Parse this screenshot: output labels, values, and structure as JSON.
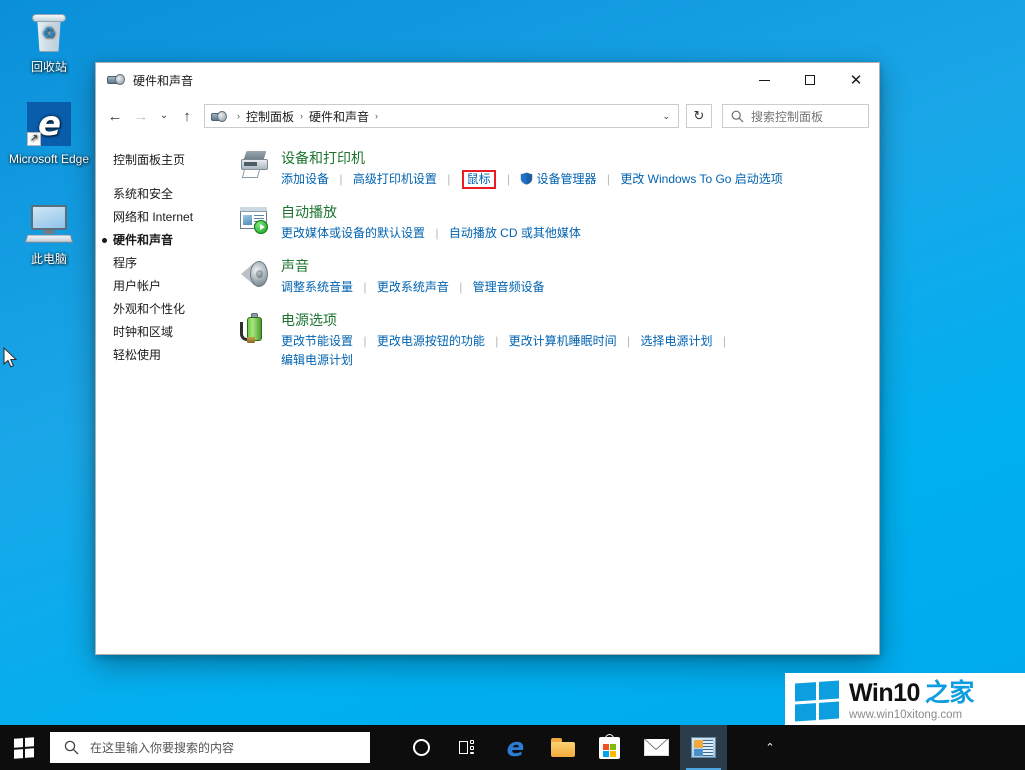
{
  "desktop": {
    "icons": [
      {
        "name": "recycle-bin",
        "label": "回收站"
      },
      {
        "name": "microsoft-edge",
        "label": "Microsoft Edge"
      },
      {
        "name": "this-pc",
        "label": "此电脑"
      }
    ]
  },
  "window": {
    "title": "硬件和声音",
    "controls": {
      "minimize": "—",
      "maximize": "□",
      "close": "✕"
    },
    "nav": {
      "back": "←",
      "forward": "→",
      "recent": "⌄",
      "up": "↑"
    },
    "address": {
      "crumbs": [
        "控制面板",
        "硬件和声音"
      ],
      "separator": "›",
      "dropdown": "⌄"
    },
    "refresh": "↻",
    "search": {
      "placeholder": "搜索控制面板",
      "icon": "search-icon"
    }
  },
  "sidebar": {
    "home": "控制面板主页",
    "items": [
      {
        "label": "系统和安全",
        "active": false
      },
      {
        "label": "网络和 Internet",
        "active": false
      },
      {
        "label": "硬件和声音",
        "active": true
      },
      {
        "label": "程序",
        "active": false
      },
      {
        "label": "用户帐户",
        "active": false
      },
      {
        "label": "外观和个性化",
        "active": false
      },
      {
        "label": "时钟和区域",
        "active": false
      },
      {
        "label": "轻松使用",
        "active": false
      }
    ]
  },
  "categories": [
    {
      "icon": "printer-icon",
      "title": "设备和打印机",
      "links": [
        {
          "label": "添加设备",
          "highlighted": false,
          "shield": false
        },
        {
          "label": "高级打印机设置",
          "highlighted": false,
          "shield": false
        },
        {
          "label": "鼠标",
          "highlighted": true,
          "shield": false
        },
        {
          "label": "设备管理器",
          "highlighted": false,
          "shield": true
        },
        {
          "label": "更改 Windows To Go 启动选项",
          "highlighted": false,
          "shield": false
        }
      ]
    },
    {
      "icon": "autoplay-icon",
      "title": "自动播放",
      "links": [
        {
          "label": "更改媒体或设备的默认设置",
          "highlighted": false,
          "shield": false
        },
        {
          "label": "自动播放 CD 或其他媒体",
          "highlighted": false,
          "shield": false
        }
      ]
    },
    {
      "icon": "sound-icon",
      "title": "声音",
      "links": [
        {
          "label": "调整系统音量",
          "highlighted": false,
          "shield": false
        },
        {
          "label": "更改系统声音",
          "highlighted": false,
          "shield": false
        },
        {
          "label": "管理音频设备",
          "highlighted": false,
          "shield": false
        }
      ]
    },
    {
      "icon": "power-icon",
      "title": "电源选项",
      "links": [
        {
          "label": "更改节能设置",
          "highlighted": false,
          "shield": false
        },
        {
          "label": "更改电源按钮的功能",
          "highlighted": false,
          "shield": false
        },
        {
          "label": "更改计算机睡眠时间",
          "highlighted": false,
          "shield": false
        },
        {
          "label": "选择电源计划",
          "highlighted": false,
          "shield": false
        },
        {
          "label": "编辑电源计划",
          "highlighted": false,
          "shield": false
        }
      ]
    }
  ],
  "watermark": {
    "title": "Win10",
    "title_accent": "之家",
    "url": "www.win10xitong.com"
  },
  "taskbar": {
    "start": "start-button",
    "search_placeholder": "在这里输入你要搜索的内容",
    "items": [
      {
        "name": "cortana-icon",
        "active": false
      },
      {
        "name": "task-view-icon",
        "active": false
      },
      {
        "name": "edge-icon",
        "active": false
      },
      {
        "name": "file-explorer-icon",
        "active": false
      },
      {
        "name": "microsoft-store-icon",
        "active": false
      },
      {
        "name": "mail-icon",
        "active": false
      },
      {
        "name": "control-panel-icon",
        "active": true
      }
    ],
    "tray_chevron": "⌃"
  },
  "colors": {
    "accent": "#0063b1",
    "heading": "#1c7430",
    "highlight": "#ea1c24",
    "desktop": "#00a8ec",
    "taskbar": "#0d0d0d"
  }
}
